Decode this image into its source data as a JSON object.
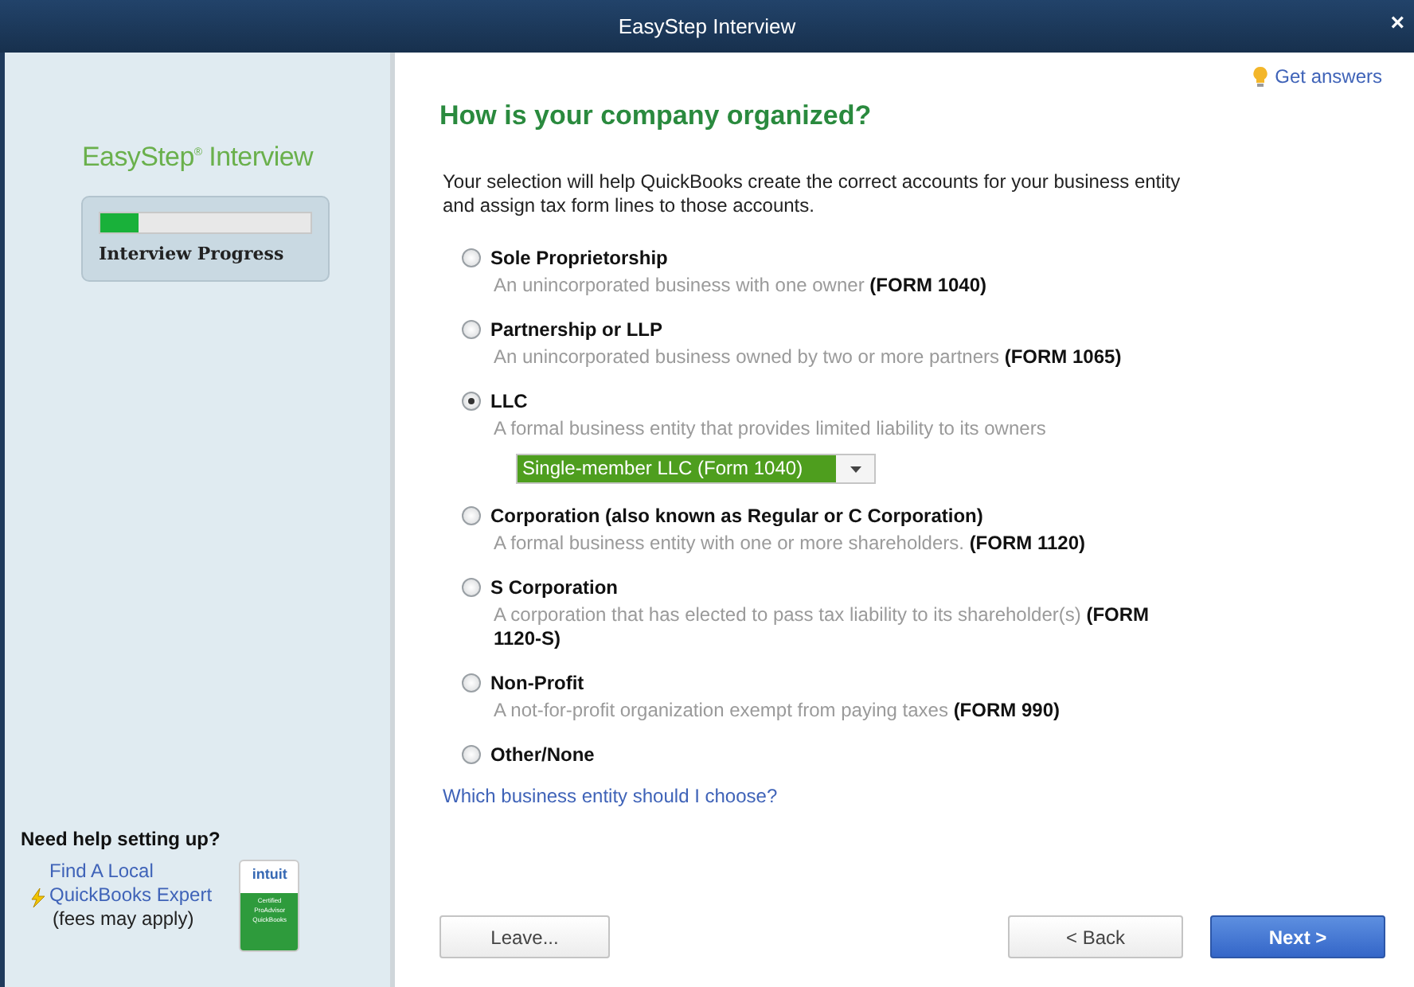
{
  "window": {
    "title": "EasyStep Interview",
    "close": "×"
  },
  "sidebar": {
    "logo": "EasyStep$^{®}$ Interview",
    "progress": {
      "label": "Interview Progress",
      "level": 0.18
    },
    "help": {
      "heading": "Need help setting up?",
      "link": "Find A Local QuickBooks Expert",
      "note": "(fees may apply)",
      "badge_brand": "intuit",
      "badge_lines": [
        "Certified",
        "ProAdvisor",
        "QuickBooks"
      ]
    }
  },
  "help_link": "Get answers",
  "heading": "How is your company organized?",
  "intro": "Your selection will help QuickBooks create the correct accounts for your business entity and assign tax form lines to those accounts.",
  "options": [
    {
      "label": "Sole Proprietorship",
      "description": "An unincorporated business with one owner **(FORM 1040)**",
      "selected": false
    },
    {
      "label": "Partnership or LLP",
      "description": "An unincorporated business owned by two or more partners **(FORM 1065)**",
      "selected": false
    },
    {
      "label": "LLC",
      "description": "A formal business entity that provides limited liability to its owners",
      "selected": true,
      "dropdown": "Single-member LLC (Form 1040)"
    },
    {
      "label": "Corporation (also known as Regular or C Corporation)",
      "description": "A formal business entity with one or more shareholders. **(FORM 1120)**",
      "selected": false
    },
    {
      "label": "S Corporation",
      "description": "A corporation that has elected to pass tax liability to its shareholder(s) **(FORM 1120-S)**",
      "selected": false
    },
    {
      "label": "Non-Profit",
      "description": "A not-for-profit organization exempt from paying taxes **(FORM 990)**",
      "selected": false
    },
    {
      "label": "Other/None",
      "selected": false
    }
  ],
  "entity_link": "Which business entity should I choose?",
  "buttons": [
    {
      "label": "Leave...",
      "kind": "plain"
    },
    {
      "label": "< Back",
      "kind": "plain"
    },
    {
      "label": "Next >",
      "kind": "primary"
    }
  ]
}
